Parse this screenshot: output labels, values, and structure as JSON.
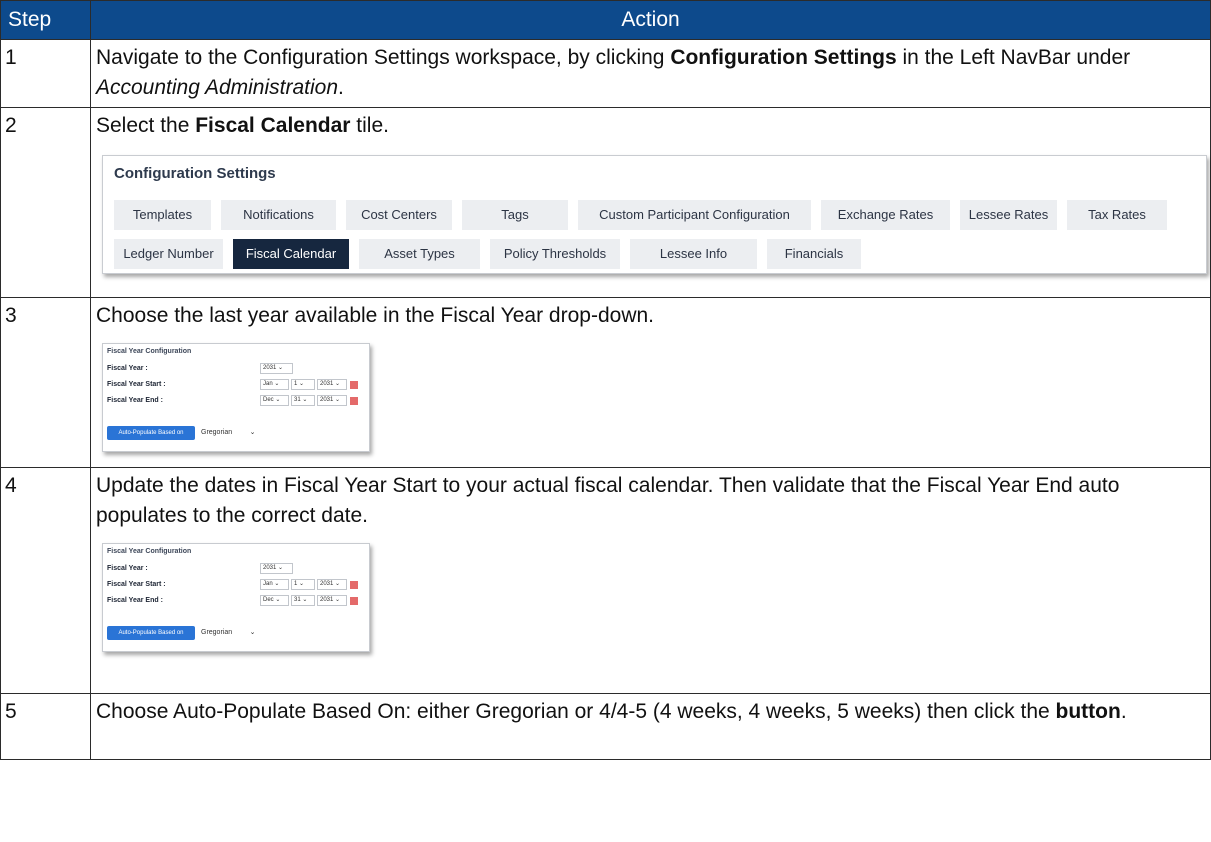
{
  "headers": {
    "step": "Step",
    "action": "Action"
  },
  "rows": [
    {
      "num": "1",
      "text": [
        {
          "t": "Navigate to the Configuration Settings workspace, by clicking "
        },
        {
          "t": "Configuration Settings",
          "style": "b"
        },
        {
          "t": " in the Left NavBar under "
        },
        {
          "t": "Accounting Administration",
          "style": "i"
        },
        {
          "t": "."
        }
      ]
    },
    {
      "num": "2",
      "text": [
        {
          "t": "Select the "
        },
        {
          "t": "Fiscal Calendar",
          "style": "b"
        },
        {
          "t": " tile."
        }
      ]
    },
    {
      "num": "3",
      "text": [
        {
          "t": "Choose the last year available in the Fiscal Year drop-down."
        }
      ]
    },
    {
      "num": "4",
      "text": [
        {
          "t": "Update the dates in Fiscal Year Start to your actual fiscal calendar. Then validate that the Fiscal Year End auto populates to the correct date."
        }
      ]
    },
    {
      "num": "5",
      "text": [
        {
          "t": "Choose Auto-Populate Based On: either Gregorian or 4/4-5 (4 weeks, 4 weeks, 5 weeks) then click the "
        },
        {
          "t": "button",
          "style": "b"
        },
        {
          "t": "."
        }
      ]
    }
  ],
  "config_settings": {
    "title": "Configuration Settings",
    "row1": [
      "Templates",
      "Notifications",
      "Cost Centers",
      "Tags",
      "Custom Participant Configuration",
      "Exchange Rates",
      "Lessee Rates",
      "Tax Rates"
    ],
    "row2": [
      "Ledger Number",
      "Fiscal Calendar",
      "Asset Types",
      "Policy Thresholds",
      "Lessee Info",
      "Financials"
    ],
    "active_tile": "Fiscal Calendar"
  },
  "fiscal_config": {
    "title": "Fiscal Year Configuration",
    "fiscal_year_label": "Fiscal Year :",
    "fiscal_year_value": "2031",
    "start_label": "Fiscal Year Start :",
    "start_month": "Jan",
    "start_day": "1",
    "start_year": "2031",
    "end_label": "Fiscal Year End :",
    "end_month": "Dec",
    "end_day": "31",
    "end_year": "2031",
    "button_label": "Auto-Populate Based on",
    "select_value": "Gregorian"
  },
  "colors": {
    "header_bg": "#0d4a8c",
    "active_tile": "#16273f",
    "button_blue": "#2a74d6",
    "calendar_icon": "#e46a6a"
  }
}
